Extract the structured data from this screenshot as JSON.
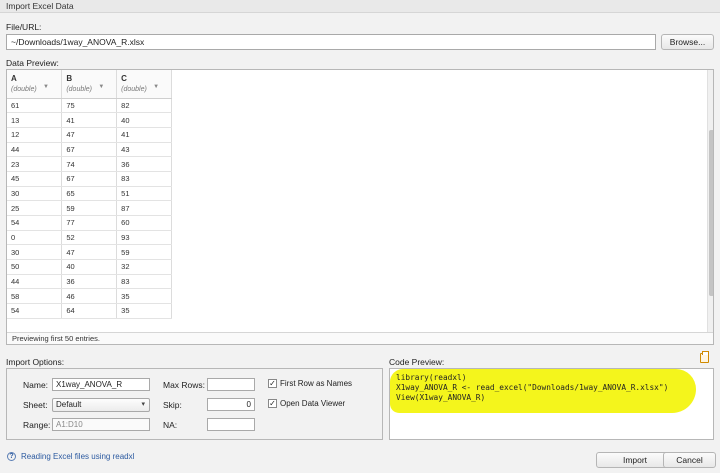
{
  "window": {
    "title": "Import Excel Data"
  },
  "file": {
    "label": "File/URL:",
    "value": "~/Downloads/1way_ANOVA_R.xlsx",
    "browse_label": "Browse..."
  },
  "data_preview": {
    "label": "Data Preview:",
    "columns": [
      {
        "name": "A",
        "type": "(double)"
      },
      {
        "name": "B",
        "type": "(double)"
      },
      {
        "name": "C",
        "type": "(double)"
      }
    ],
    "rows": [
      [
        "61",
        "75",
        "82"
      ],
      [
        "13",
        "41",
        "40"
      ],
      [
        "12",
        "47",
        "41"
      ],
      [
        "44",
        "67",
        "43"
      ],
      [
        "23",
        "74",
        "36"
      ],
      [
        "45",
        "67",
        "83"
      ],
      [
        "30",
        "65",
        "51"
      ],
      [
        "25",
        "59",
        "87"
      ],
      [
        "54",
        "77",
        "60"
      ],
      [
        "0",
        "52",
        "93"
      ],
      [
        "30",
        "47",
        "59"
      ],
      [
        "50",
        "40",
        "32"
      ],
      [
        "44",
        "36",
        "83"
      ],
      [
        "58",
        "46",
        "35"
      ],
      [
        "54",
        "64",
        "35"
      ]
    ],
    "footer": "Previewing first 50 entries."
  },
  "import_options": {
    "label": "Import Options:",
    "name_label": "Name:",
    "name_value": "X1way_ANOVA_R",
    "sheet_label": "Sheet:",
    "sheet_value": "Default",
    "range_label": "Range:",
    "range_placeholder": "A1:D10",
    "maxrows_label": "Max Rows:",
    "maxrows_value": "",
    "skip_label": "Skip:",
    "skip_value": "0",
    "na_label": "NA:",
    "na_value": "",
    "first_row_label": "First Row as Names",
    "first_row_checked": true,
    "open_viewer_label": "Open Data Viewer",
    "open_viewer_checked": true
  },
  "code_preview": {
    "label": "Code Preview:",
    "lines": [
      "library(readxl)",
      "X1way_ANOVA_R <- read_excel(\"Downloads/1way_ANOVA_R.xlsx\")",
      "View(X1way_ANOVA_R)"
    ],
    "highlight_color": "#f4f51c"
  },
  "footer": {
    "help_icon": "question-circle-icon",
    "help_label": "Reading Excel files using readxl",
    "import_label": "Import",
    "cancel_label": "Cancel"
  },
  "icons": {
    "copy": "clipboard-copy-icon",
    "sort": "triangle-down-icon"
  }
}
